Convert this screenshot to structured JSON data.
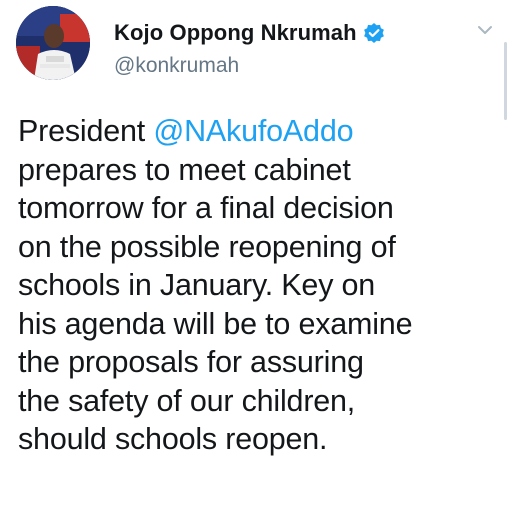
{
  "author": {
    "display_name": "Kojo Oppong Nkrumah",
    "handle": "@konkrumah",
    "verified": true,
    "avatar_icon": "profile-photo"
  },
  "tweet": {
    "lines": [
      {
        "before": "President ",
        "mention": "@NAkufoAddo",
        "after": ""
      },
      {
        "before": "prepares to meet cabinet",
        "mention": "",
        "after": ""
      },
      {
        "before": "tomorrow for a final decision",
        "mention": "",
        "after": ""
      },
      {
        "before": "on the possible reopening of",
        "mention": "",
        "after": ""
      },
      {
        "before": "schools in January. Key on",
        "mention": "",
        "after": ""
      },
      {
        "before": "his agenda will be to examine",
        "mention": "",
        "after": ""
      },
      {
        "before": "the proposals for assuring",
        "mention": "",
        "after": ""
      },
      {
        "before": "the safety of our children,",
        "mention": "",
        "after": ""
      },
      {
        "before": "should schools reopen.",
        "mention": "",
        "after": ""
      }
    ]
  },
  "icons": {
    "verified": "verified-badge-icon",
    "menu": "chevron-down-icon"
  },
  "colors": {
    "text": "#14171a",
    "secondary": "#657786",
    "link": "#1da1f2",
    "verified": "#1da1f2"
  }
}
